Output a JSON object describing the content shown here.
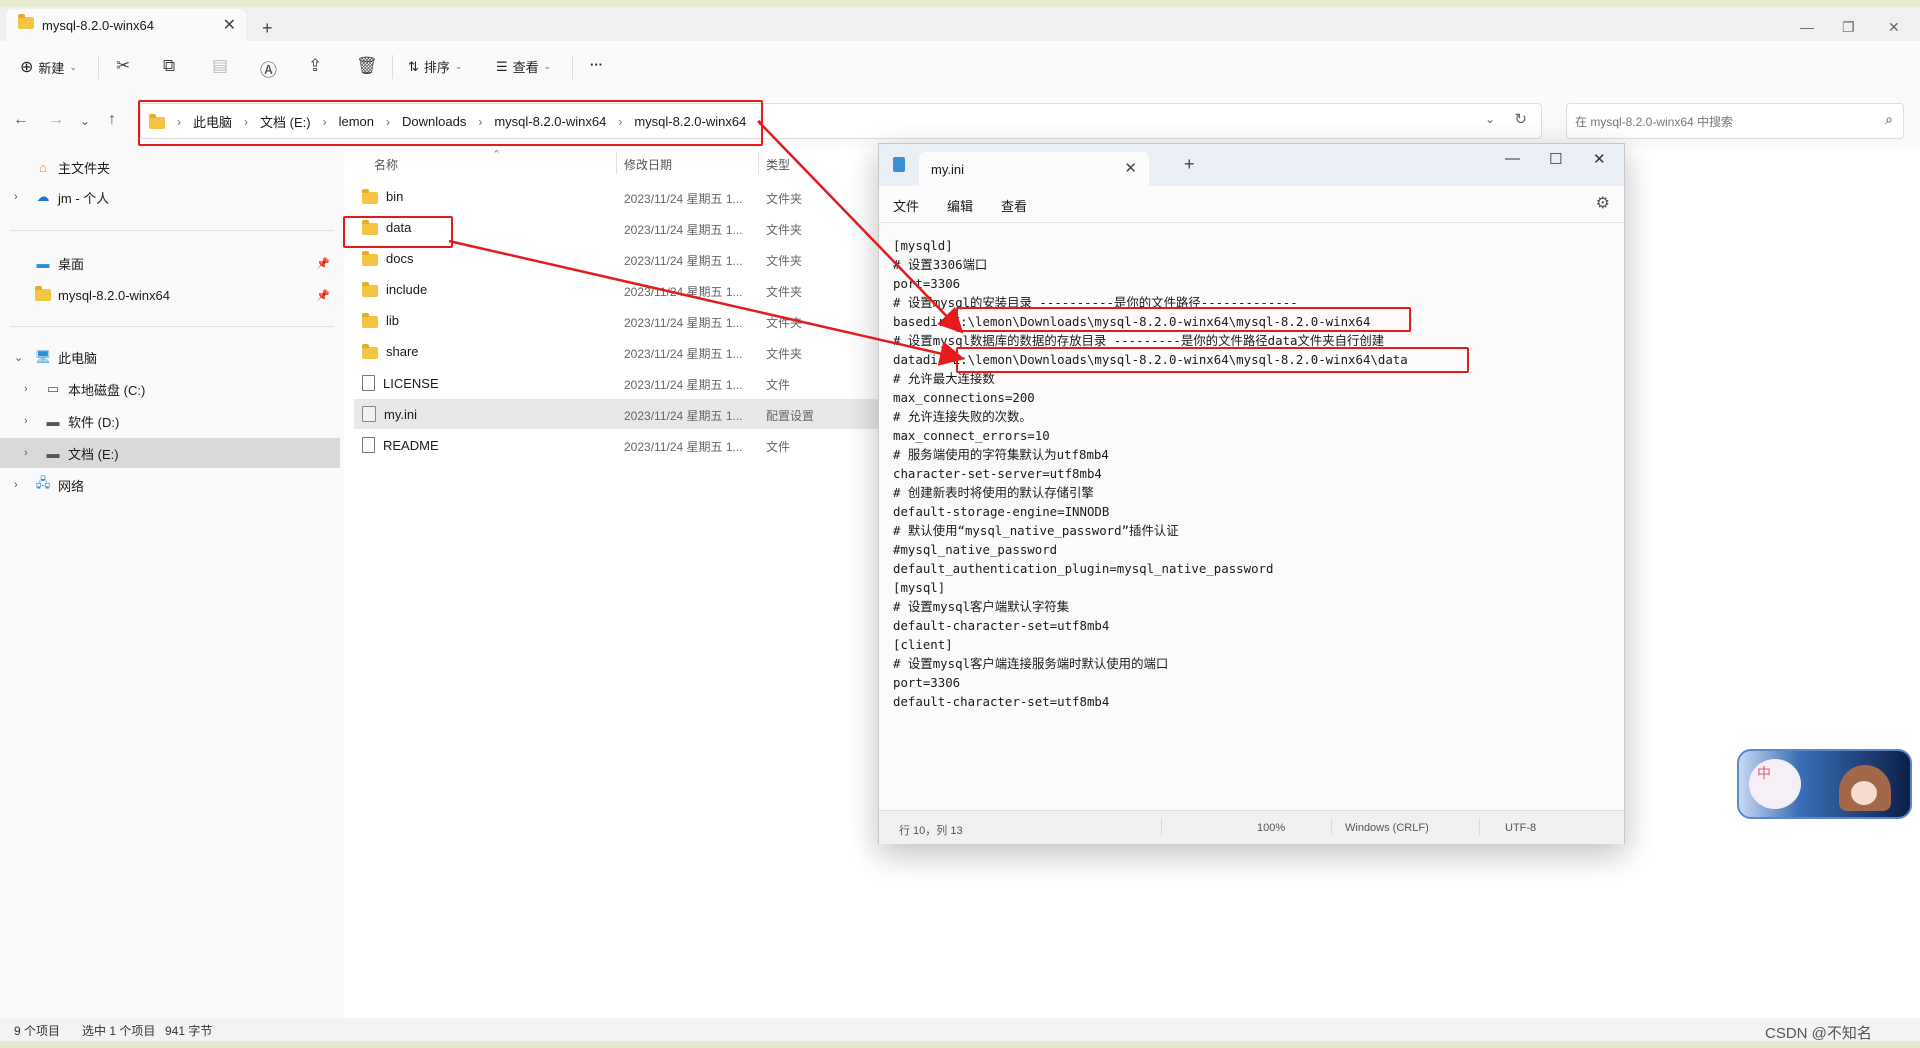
{
  "explorer": {
    "tab_title": "mysql-8.2.0-winx64",
    "commands": {
      "new": "新建",
      "sort": "排序",
      "view": "查看",
      "more": "···"
    },
    "breadcrumb": [
      "此电脑",
      "文档 (E:)",
      "lemon",
      "Downloads",
      "mysql-8.2.0-winx64",
      "mysql-8.2.0-winx64"
    ],
    "search_placeholder": "在 mysql-8.2.0-winx64 中搜索",
    "sidebar": {
      "home": "主文件夹",
      "onedrive": "jm - 个人",
      "desktop": "桌面",
      "pinned_folder": "mysql-8.2.0-winx64",
      "this_pc": "此电脑",
      "drive_c": "本地磁盘 (C:)",
      "drive_d": "软件 (D:)",
      "drive_e": "文档 (E:)",
      "network": "网络"
    },
    "columns": {
      "name": "名称",
      "date": "修改日期",
      "type": "类型"
    },
    "files": [
      {
        "name": "bin",
        "date": "2023/11/24 星期五 1...",
        "type": "文件夹",
        "kind": "folder"
      },
      {
        "name": "data",
        "date": "2023/11/24 星期五 1...",
        "type": "文件夹",
        "kind": "folder"
      },
      {
        "name": "docs",
        "date": "2023/11/24 星期五 1...",
        "type": "文件夹",
        "kind": "folder"
      },
      {
        "name": "include",
        "date": "2023/11/24 星期五 1...",
        "type": "文件夹",
        "kind": "folder"
      },
      {
        "name": "lib",
        "date": "2023/11/24 星期五 1...",
        "type": "文件夹",
        "kind": "folder"
      },
      {
        "name": "share",
        "date": "2023/11/24 星期五 1...",
        "type": "文件夹",
        "kind": "folder"
      },
      {
        "name": "LICENSE",
        "date": "2023/11/24 星期五 1...",
        "type": "文件",
        "kind": "file"
      },
      {
        "name": "my.ini",
        "date": "2023/11/24 星期五 1...",
        "type": "配置设置",
        "kind": "config",
        "selected": true
      },
      {
        "name": "README",
        "date": "2023/11/24 星期五 1...",
        "type": "文件",
        "kind": "file"
      }
    ],
    "status": {
      "count": "9 个项目",
      "selection": "选中 1 个项目",
      "size": "941 字节"
    }
  },
  "notepad": {
    "tab_title": "my.ini",
    "menu": [
      "文件",
      "编辑",
      "查看"
    ],
    "content": "[mysqld]\n# 设置3306端口\nport=3306\n# 设置mysql的安装目录 ----------是你的文件路径-------------\nbasedir=E:\\lemon\\Downloads\\mysql-8.2.0-winx64\\mysql-8.2.0-winx64\n# 设置mysql数据库的数据的存放目录 ---------是你的文件路径data文件夹自行创建\ndatadir=E:\\lemon\\Downloads\\mysql-8.2.0-winx64\\mysql-8.2.0-winx64\\data\n# 允许最大连接数\nmax_connections=200\n# 允许连接失败的次数。\nmax_connect_errors=10\n# 服务端使用的字符集默认为utf8mb4\ncharacter-set-server=utf8mb4\n# 创建新表时将使用的默认存储引擎\ndefault-storage-engine=INNODB\n# 默认使用“mysql_native_password”插件认证\n#mysql_native_password\ndefault_authentication_plugin=mysql_native_password\n[mysql]\n# 设置mysql客户端默认字符集\ndefault-character-set=utf8mb4\n[client]\n# 设置mysql客户端连接服务端时默认使用的端口\nport=3306\ndefault-character-set=utf8mb4",
    "status": {
      "position": "行 10，列 13",
      "zoom": "100%",
      "line_ending": "Windows (CRLF)",
      "encoding": "UTF-8"
    }
  },
  "widget": {
    "label": "中"
  },
  "watermark": "CSDN @不知名",
  "colors": {
    "annotation_red": "#e31b1b",
    "folder": "#f4c545",
    "selected_row": "#e8e8e8"
  }
}
